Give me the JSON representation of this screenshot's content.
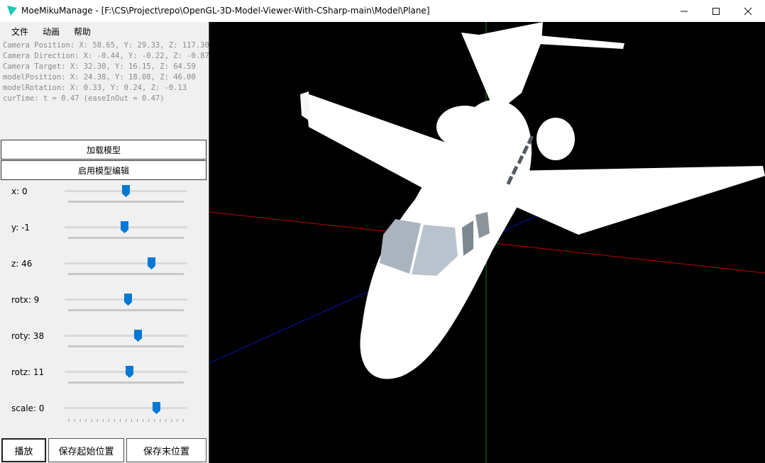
{
  "window": {
    "title": "MoeMikuManage - [F:\\CS\\Project\\repo\\OpenGL-3D-Model-Viewer-With-CSharp-main\\Model\\Plane]",
    "icon": "app-logo-icon",
    "controls": [
      "minimize-icon",
      "maximize-icon",
      "close-icon"
    ]
  },
  "menu": {
    "items": [
      "文件",
      "动画",
      "帮助"
    ]
  },
  "info": {
    "lines": [
      "Camera Position: X: 58.65, Y: 29.33, Z: 117.30",
      "Camera Direction: X: -0.44, Y: -0.22, Z: -0.87",
      "Camera Target: X: 32.30, Y: 16.15, Z: 64.59",
      "modelPosition: X: 24.38, Y: 18.08, Z: 46.00",
      "modelRotation: X: 0.33, Y: 0.24, Z: -0.13",
      "curTime: t = 0.47 (easeInOut = 0.47)"
    ]
  },
  "buttons": {
    "load_model": "加载模型",
    "enable_edit": "启用模型编辑"
  },
  "sliders": [
    {
      "label": "x: 0",
      "level": 0.5
    },
    {
      "label": "y: -1",
      "level": 0.49
    },
    {
      "label": "z: 46",
      "level": 0.71
    },
    {
      "label": "rotx: 9",
      "level": 0.52
    },
    {
      "label": "roty: 38",
      "level": 0.6
    },
    {
      "label": "rotz: 11",
      "level": 0.53
    },
    {
      "label": "scale: 0",
      "level": 0.75
    }
  ],
  "bottom": {
    "play": "播放",
    "save_start": "保存起始位置",
    "save_end": "保存末位置"
  },
  "colors": {
    "accent": "#0078d4",
    "x_axis": "#c00000",
    "y_axis": "#1a7a1a",
    "z_axis": "#1010b0",
    "viewport_bg": "#000000"
  }
}
